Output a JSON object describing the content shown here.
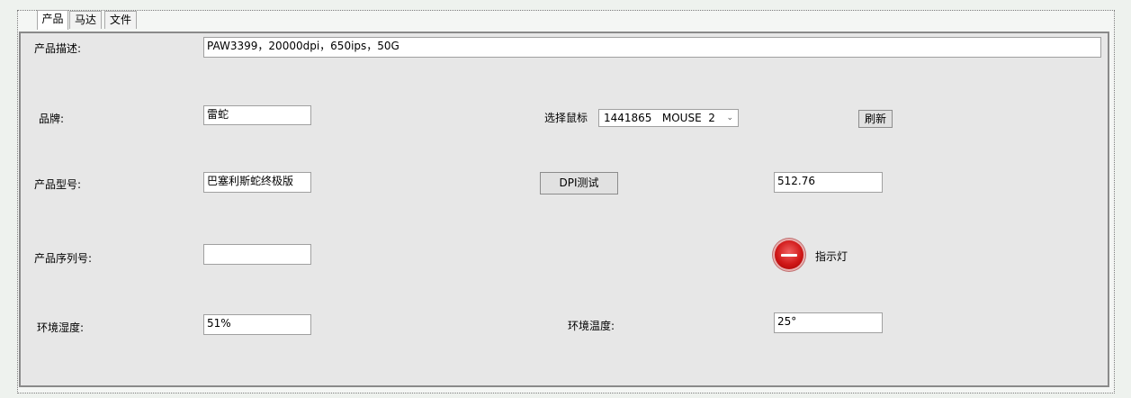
{
  "tabs": [
    "产品",
    "马达",
    "文件"
  ],
  "labels": {
    "description": "产品描述:",
    "brand": "品牌:",
    "model": "产品型号:",
    "serial": "产品序列号:",
    "humidity": "环境湿度:",
    "select_mouse": "选择鼠标",
    "temperature": "环境温度:",
    "indicator": "指示灯"
  },
  "values": {
    "description": "PAW3399，20000dpi，650ips，50G",
    "brand": "雷蛇",
    "model": "巴塞利斯蛇终极版",
    "serial": "",
    "humidity": "51%",
    "dpi_result": "512.76",
    "temperature": "25°"
  },
  "mouse_select": {
    "selected": "1441865   MOUSE  2"
  },
  "buttons": {
    "refresh": "刷新",
    "dpi_test": "DPI测试"
  },
  "indicator": {
    "state": "off",
    "color": "#d01818"
  }
}
